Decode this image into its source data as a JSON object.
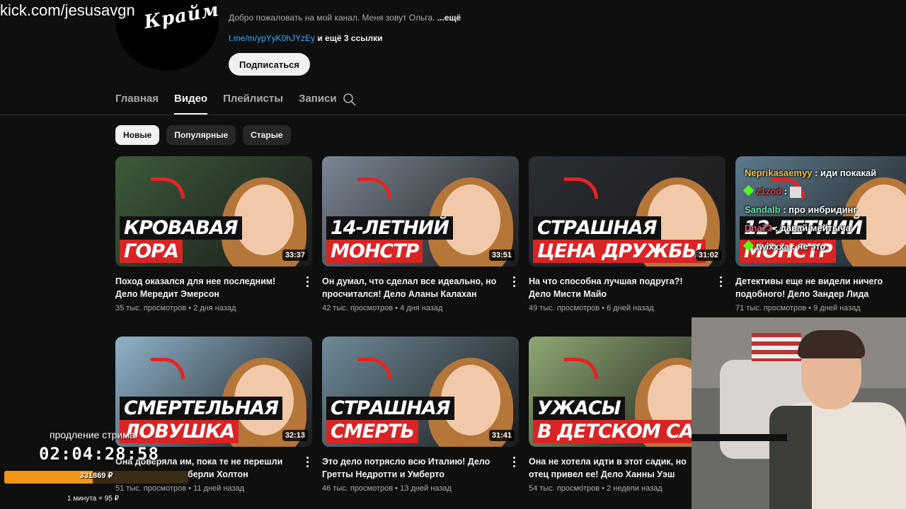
{
  "channel": {
    "avatar_text": "Крайм",
    "description_text": "Добро пожаловать на мой канал. Меня зовут Ольга.",
    "description_more": "...ещё",
    "link": "t.me/m/ypYyK0hJYzEy",
    "more_links": "и ещё 3 ссылки",
    "subscribe_label": "Подписаться"
  },
  "tabs": [
    "Главная",
    "Видео",
    "Плейлисты",
    "Записи"
  ],
  "active_tab": "Видео",
  "filters": [
    "Новые",
    "Популярные",
    "Старые"
  ],
  "active_filter": "Новые",
  "videos": [
    {
      "title": "Поход оказался для нее последним! Дело Мередит Эмерсон",
      "views": "35 тыс. просмотров",
      "age": "2 дня назад",
      "duration": "33:37",
      "thumb_line1": "КРОВАВАЯ",
      "thumb_line2": "ГОРА",
      "bg": "#3d5a3a"
    },
    {
      "title": "Он думал, что сделал все идеально, но просчитался! Дело Аланы Калахан",
      "views": "42 тыс. просмотров",
      "age": "4 дня назад",
      "duration": "33:51",
      "thumb_line1": "14-ЛЕТНИЙ",
      "thumb_line2": "МОНСТР",
      "bg": "#7b8794"
    },
    {
      "title": "На что способна лучшая подруга?! Дело Мисти Майо",
      "views": "49 тыс. просмотров",
      "age": "6 дней назад",
      "duration": "31:02",
      "thumb_line1": "СТРАШНАЯ",
      "thumb_line2": "ЦЕНА ДРУЖБЫ",
      "bg": "#2a2e33"
    },
    {
      "title": "Детективы еще не видели ничего подобного! Дело Зандер Лида",
      "views": "71 тыс. просмотров",
      "age": "9 дней назад",
      "duration": "",
      "thumb_line1": "12-ЛЕТНИЙ",
      "thumb_line2": "МОНСТР",
      "bg": "#5d7a8c"
    },
    {
      "title": "Она доверяла им, пока те не перешли черту! Дело Кимберли Холтон",
      "views": "51 тыс. просмотров",
      "age": "11 дней назад",
      "duration": "32:13",
      "thumb_line1": "СМЕРТЕЛЬНАЯ",
      "thumb_line2": "ЛОВУШКА",
      "bg": "#8fb2c9"
    },
    {
      "title": "Это дело потрясло всю Италию! Дело Гретты Недротти и Умберто",
      "views": "46 тыс. просмотров",
      "age": "13 дней назад",
      "duration": "31:41",
      "thumb_line1": "СТРАШНАЯ",
      "thumb_line2": "СМЕРТЬ",
      "bg": "#6f8a99"
    },
    {
      "title": "Она не хотела идти в этот садик, но отец привел ее! Дело Ханны Уэш",
      "views": "54 тыс. просмотров",
      "age": "2 недели назад",
      "duration": "",
      "thumb_line1": "УЖАСЫ",
      "thumb_line2": "В ДЕТСКОМ САДУ",
      "bg": "#8fa873"
    }
  ],
  "overlay": {
    "kick_url": "kick.com/jesusavgn",
    "chat": [
      {
        "user": "Neprikasaemyy",
        "color": "#f5c042",
        "msg": " : иди покакай",
        "badge": false,
        "emote": false
      },
      {
        "user": "z1zod",
        "color": "#e03a3a",
        "msg": " :",
        "badge": true,
        "emote": true
      },
      {
        "user": "Sandalb",
        "color": "#6ce0b0",
        "msg": " : про инбридинг",
        "badge": false,
        "emote": false
      },
      {
        "user": "Dna73",
        "color": "#e05a7a",
        "msg": " : давай мейтыча",
        "badge": false,
        "emote": false
      },
      {
        "user": "twixxxa",
        "color": "#ffffff",
        "msg": " : не это",
        "badge": true,
        "emote": false
      }
    ],
    "timer_label": "продление стрима",
    "timer": "02:04:28:58",
    "donation_total": "331869 ₽",
    "donation_progress": 0.48,
    "rate_text": "1 минута = 95 ₽"
  }
}
